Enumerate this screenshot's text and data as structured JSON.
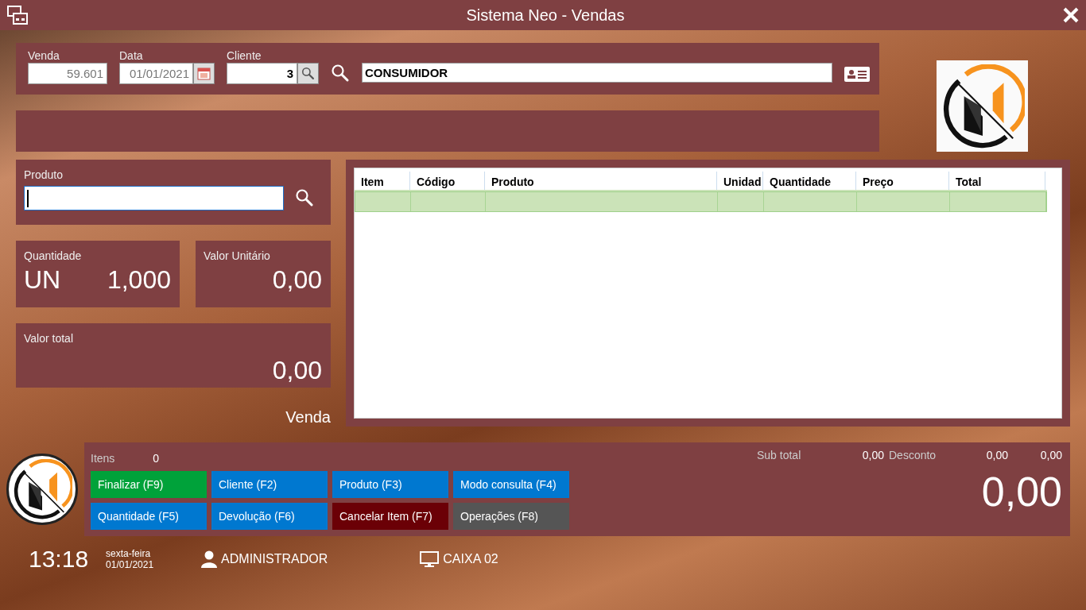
{
  "window": {
    "title": "Sistema Neo - Vendas"
  },
  "header": {
    "venda": {
      "label": "Venda",
      "value": "59.601"
    },
    "data": {
      "label": "Data",
      "value": "01/01/2021"
    },
    "cliente": {
      "label": "Cliente",
      "value": "3"
    },
    "cliente_nome": "CONSUMIDOR"
  },
  "produto": {
    "label": "Produto"
  },
  "quantidade": {
    "label": "Quantidade",
    "unit": "UN",
    "value": "1,000"
  },
  "valor_unitario": {
    "label": "Valor Unitário",
    "value": "0,00"
  },
  "valor_total": {
    "label": "Valor total",
    "value": "0,00"
  },
  "mode": "Venda",
  "table": {
    "columns": [
      "Item",
      "Código",
      "Produto",
      "Unidad",
      "Quantidade",
      "Preço",
      "Total"
    ]
  },
  "summary": {
    "itens_label": "Itens",
    "itens_value": "0",
    "subtotal_label": "Sub total",
    "subtotal_value": "0,00",
    "desconto_label": "Desconto",
    "desconto_value": "0,00",
    "column_3": "0,00",
    "total": "0,00"
  },
  "buttons": [
    {
      "label": "Finalizar (F9)",
      "color": "#00a23a"
    },
    {
      "label": "Cliente (F2)",
      "color": "#0078d0"
    },
    {
      "label": "Produto (F3)",
      "color": "#0078d0"
    },
    {
      "label": "Modo consulta (F4)",
      "color": "#0078d0"
    },
    {
      "label": "Quantidade (F5)",
      "color": "#0078d0"
    },
    {
      "label": "Devolução (F6)",
      "color": "#0078d0"
    },
    {
      "label": "Cancelar Item (F7)",
      "color": "#6b0006"
    },
    {
      "label": "Operações (F8)",
      "color": "#555555"
    }
  ],
  "status_bar": {
    "time": "13:18",
    "weekday": "sexta-feira",
    "date": "01/01/2021",
    "user": "ADMINISTRADOR",
    "terminal": "CAIXA 02"
  }
}
